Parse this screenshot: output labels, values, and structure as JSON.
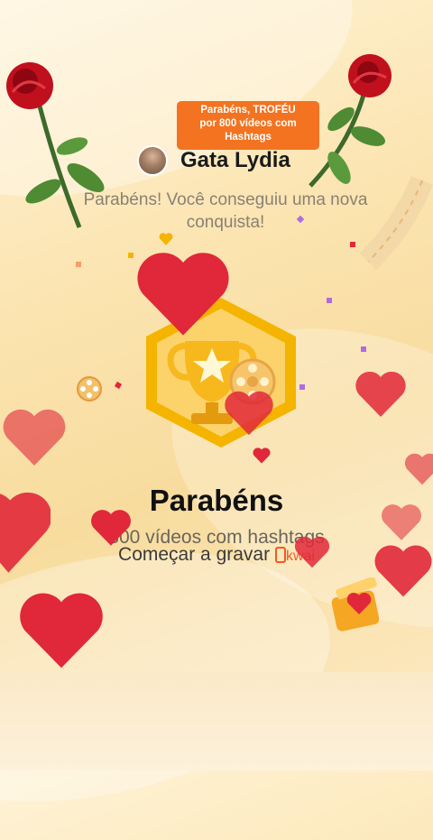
{
  "badge": {
    "line1": "Parabéns, TROFÉU",
    "line2": "por  800 vídeos  com",
    "line3": "Hashtags"
  },
  "user": {
    "name": "Gata Lydia",
    "avatar_icon": "user-avatar"
  },
  "subtitle": {
    "line1": "Parabéns! Você conseguiu uma nova",
    "line2": "conquista!"
  },
  "achievement": {
    "title": "Parabéns",
    "description": "800 vídeos com hashtags"
  },
  "cta": {
    "label": "Começar a gravar",
    "brand": "kwai"
  },
  "colors": {
    "badge": "#f37321",
    "heart": "#e0283a",
    "accent": "#f15a24",
    "gold": "#f4b400"
  },
  "icons": [
    "rose-icon",
    "heart-icon",
    "trophy-icon",
    "film-reel-icon",
    "clapperboard-icon",
    "kwai-logo-icon"
  ]
}
